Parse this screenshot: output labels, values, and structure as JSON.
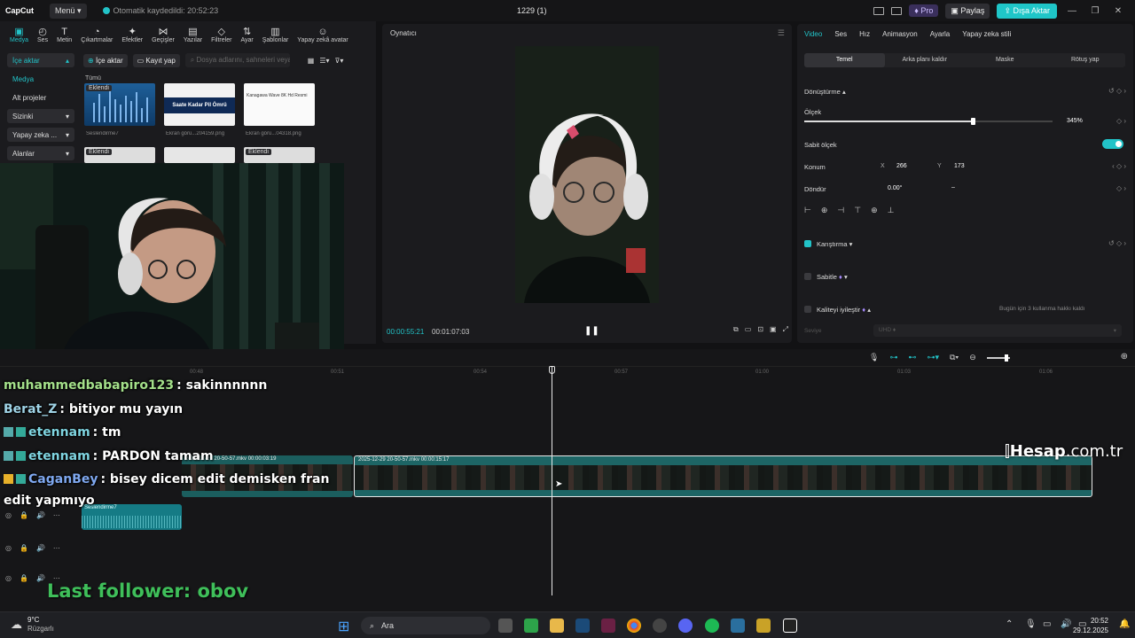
{
  "titlebar": {
    "logo": "CapCut",
    "menu": "Menü",
    "autosave": "Otomatik kaydedildi: 20:52:23",
    "project": "1229 (1)",
    "pro": "Pro",
    "share": "Paylaş",
    "export": "Dışa Aktar"
  },
  "tool_tabs": [
    "Medya",
    "Ses",
    "Metin",
    "Çıkartmalar",
    "Efektler",
    "Geçişler",
    "Yazılar",
    "Filtreler",
    "Ayar",
    "Şablonlar",
    "Yapay zekâ avatar"
  ],
  "sidenav": [
    {
      "label": "İçe aktar",
      "chev": "▴"
    },
    {
      "label": "Medya",
      "chev": ""
    },
    {
      "label": "Alt projeler",
      "chev": ""
    },
    {
      "label": "Sizinki",
      "chev": "▾"
    },
    {
      "label": "Yapay zeka ...",
      "chev": "▾"
    },
    {
      "label": "Alanlar",
      "chev": "▾"
    }
  ],
  "media_toolbar": {
    "import": "İçe aktar",
    "record": "Kayıt yap",
    "search_placeholder": "Dosya adlarını, sahneleri veya..."
  },
  "media": {
    "all": "Tümü",
    "added": "Eklendi",
    "items": [
      {
        "caption": "Seslendirme7",
        "text": ""
      },
      {
        "caption": "Ekran görü...204159.png",
        "text": "Saate Kadar Pil Ömrü"
      },
      {
        "caption": "Ekran görü...04318.png",
        "text": "Kanagawa Wave 8K Hd Resmi"
      }
    ]
  },
  "player": {
    "title": "Oynatıcı",
    "time_current": "00:00:55:21",
    "time_total": "00:01:07:03"
  },
  "right_panel": {
    "tabs": [
      "Video",
      "Ses",
      "Hız",
      "Animasyon",
      "Ayarla",
      "Yapay zeka stili"
    ],
    "subtabs": [
      "Temel",
      "Arka planı kaldır",
      "Maske",
      "Rötuş yap"
    ],
    "transform": "Dönüştürme",
    "scale_label": "Ölçek",
    "scale_value": "345%",
    "scale_fraction": 0.68,
    "uniform_scale": "Sabit ölçek",
    "position_label": "Konum",
    "pos_x_label": "X",
    "pos_x": "266",
    "pos_y_label": "Y",
    "pos_y": "173",
    "rotate_label": "Döndür",
    "rotate_value": "0.00°",
    "blend": "Karıştırma",
    "stabilize": "Sabitle",
    "enhance": "Kaliteyi iyileştir",
    "enhance_note": "Bugün için 3 kullanma hakkı kaldı",
    "quality_label": "Seviye",
    "quality_value": "UHD"
  },
  "timeline": {
    "ruler": [
      "00:48",
      "00:51",
      "00:54",
      "00:57",
      "01:00",
      "01:03",
      "01:06"
    ],
    "clip_prev_label": "2025-12-29 20-50-57.mkv  00:00:03:19",
    "clip_main_label": "2025-12-29 20-50-57.mkv  00:00:15:17",
    "audio_label": "Seslendirme7"
  },
  "chat": [
    {
      "user": "muhammedbabapiro123",
      "msg": ": sakinnnnnn",
      "color": "#a4e08a"
    },
    {
      "user": "Berat_Z",
      "msg": ": bitiyor mu yayın",
      "color": "#9fd3e6"
    },
    {
      "user": "etennam",
      "msg": ": tm",
      "color": "#7fd4e0"
    },
    {
      "user": "etennam",
      "msg": ": PARDON tamam",
      "color": "#7fd4e0"
    },
    {
      "user": "CaganBey",
      "msg": ": bisey dicem edit demisken fran",
      "color": "#7fa8f0"
    },
    {
      "user": "",
      "msg": "edit yapmıyo",
      "color": "#ffffff"
    }
  ],
  "last_follower": "Last follower: obov",
  "watermark": {
    "bold": "Hesap",
    "rest": ".com.tr"
  },
  "taskbar": {
    "temp": "9°C",
    "weather": "Rüzgarlı",
    "search": "Ara",
    "time": "20:52",
    "date": "29.12.2025"
  }
}
